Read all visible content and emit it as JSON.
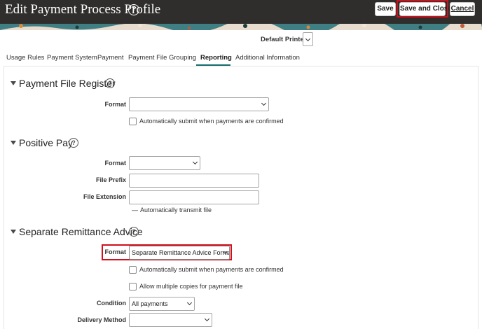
{
  "header": {
    "title": "Edit Payment Process Profile",
    "buttons": {
      "save": "Save",
      "save_and_close": "Save and Close",
      "cancel": "Cancel"
    }
  },
  "printer": {
    "label": "Default Printer",
    "value": ""
  },
  "tabs": [
    {
      "label": "Usage Rules"
    },
    {
      "label": "Payment System"
    },
    {
      "label": "Payment"
    },
    {
      "label": "Payment File"
    },
    {
      "label": "Grouping"
    },
    {
      "label": "Reporting",
      "active": true
    },
    {
      "label": "Additional Information"
    }
  ],
  "sections": {
    "payment_file_register": {
      "title": "Payment File Register",
      "format_label": "Format",
      "format_value": "",
      "auto_submit_label": "Automatically submit when payments are confirmed",
      "auto_submit_checked": false
    },
    "positive_pay": {
      "title": "Positive Pay",
      "format_label": "Format",
      "format_value": "",
      "file_prefix_label": "File Prefix",
      "file_prefix_value": "",
      "file_extension_label": "File Extension",
      "file_extension_value": "",
      "auto_transmit_label": "Automatically transmit file",
      "auto_transmit_marker": "—"
    },
    "separate_remittance_advice": {
      "title": "Separate Remittance Advice",
      "format_label": "Format",
      "format_value": "Separate Remittance Advice Format",
      "auto_submit_label": "Automatically submit when payments are confirmed",
      "auto_submit_checked": false,
      "multiple_copies_label": "Allow multiple copies for payment file",
      "multiple_copies_checked": false,
      "condition_label": "Condition",
      "condition_value": "All payments",
      "delivery_method_label": "Delivery Method",
      "delivery_method_value": ""
    }
  },
  "icons": {
    "help": "?",
    "collapse": "triangle-down"
  },
  "colors": {
    "header_bg": "#2f2e2c",
    "highlight": "#d0101c",
    "tab_underline": "#146b6b"
  }
}
